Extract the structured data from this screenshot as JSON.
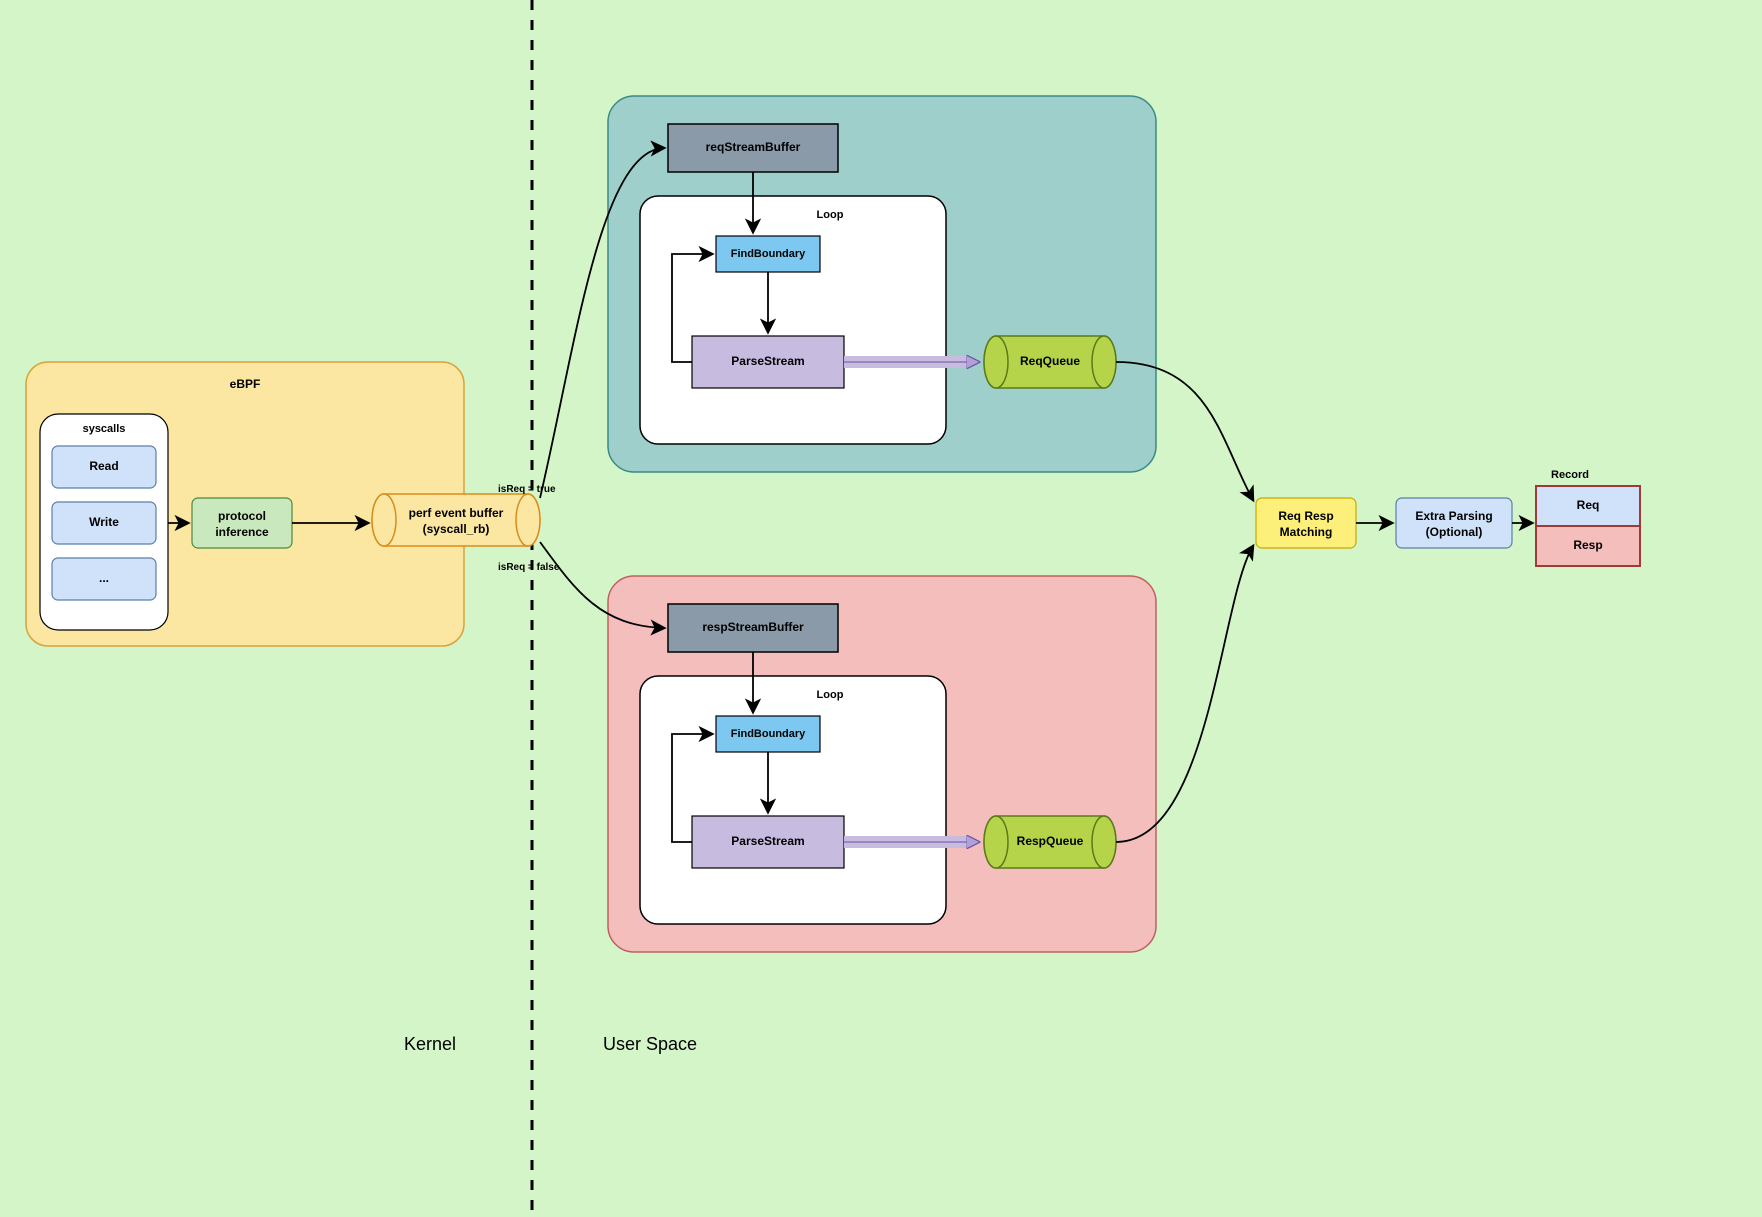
{
  "ebpf": {
    "title": "eBPF",
    "syscalls_title": "syscalls",
    "read": "Read",
    "write": "Write",
    "more": "...",
    "protocol_inference": "protocol\ninference",
    "perf_buffer": "perf event buffer\n(syscall_rb)"
  },
  "boundary": {
    "kernel": "Kernel",
    "user": "User Space"
  },
  "edges": {
    "isReqTrue": "isReq = true",
    "isReqFalse": "isReq = false"
  },
  "req": {
    "buffer": "reqStreamBuffer",
    "loop": "Loop",
    "find": "FindBoundary",
    "parse": "ParseStream",
    "queue": "ReqQueue"
  },
  "resp": {
    "buffer": "respStreamBuffer",
    "loop": "Loop",
    "find": "FindBoundary",
    "parse": "ParseStream",
    "queue": "RespQueue"
  },
  "matching": "Req Resp\nMatching",
  "extra": "Extra Parsing\n(Optional)",
  "record": {
    "title": "Record",
    "req": "Req",
    "resp": "Resp"
  }
}
